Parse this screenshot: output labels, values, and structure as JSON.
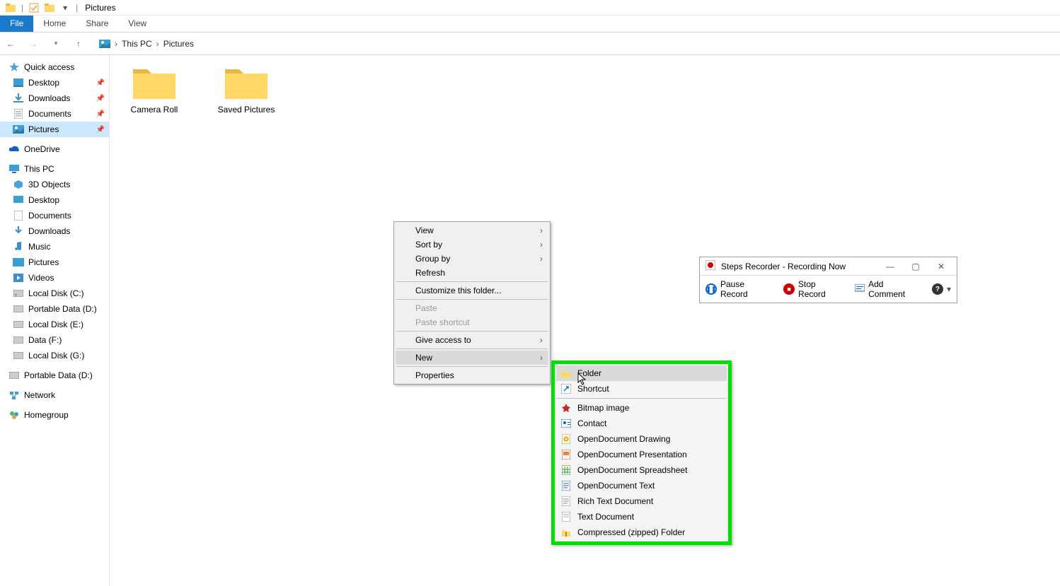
{
  "window_title": "Pictures",
  "ribbon": {
    "file": "File",
    "home": "Home",
    "share": "Share",
    "view": "View"
  },
  "breadcrumb": {
    "root": "This PC",
    "current": "Pictures"
  },
  "sidebar": {
    "quick_access": "Quick access",
    "pinned": [
      {
        "label": "Desktop"
      },
      {
        "label": "Downloads"
      },
      {
        "label": "Documents"
      },
      {
        "label": "Pictures"
      }
    ],
    "onedrive": "OneDrive",
    "thispc": "This PC",
    "thispc_items": [
      {
        "label": "3D Objects"
      },
      {
        "label": "Desktop"
      },
      {
        "label": "Documents"
      },
      {
        "label": "Downloads"
      },
      {
        "label": "Music"
      },
      {
        "label": "Pictures"
      },
      {
        "label": "Videos"
      },
      {
        "label": "Local Disk (C:)"
      },
      {
        "label": "Portable Data (D:)"
      },
      {
        "label": "Local Disk (E:)"
      },
      {
        "label": "Data (F:)"
      },
      {
        "label": "Local Disk (G:)"
      }
    ],
    "portable": "Portable Data (D:)",
    "network": "Network",
    "homegroup": "Homegroup"
  },
  "folders": [
    {
      "label": "Camera Roll"
    },
    {
      "label": "Saved Pictures"
    }
  ],
  "context_menu": {
    "view": "View",
    "sort_by": "Sort by",
    "group_by": "Group by",
    "refresh": "Refresh",
    "customize": "Customize this folder...",
    "paste": "Paste",
    "paste_shortcut": "Paste shortcut",
    "give_access": "Give access to",
    "new": "New",
    "properties": "Properties"
  },
  "new_submenu": {
    "folder": "Folder",
    "shortcut": "Shortcut",
    "bitmap": "Bitmap image",
    "contact": "Contact",
    "od_drawing": "OpenDocument Drawing",
    "od_presentation": "OpenDocument Presentation",
    "od_spreadsheet": "OpenDocument Spreadsheet",
    "od_text": "OpenDocument Text",
    "rtf": "Rich Text Document",
    "txt": "Text Document",
    "zip": "Compressed (zipped) Folder"
  },
  "recorder": {
    "title": "Steps Recorder - Recording Now",
    "pause": "Pause Record",
    "stop": "Stop Record",
    "comment": "Add Comment"
  }
}
